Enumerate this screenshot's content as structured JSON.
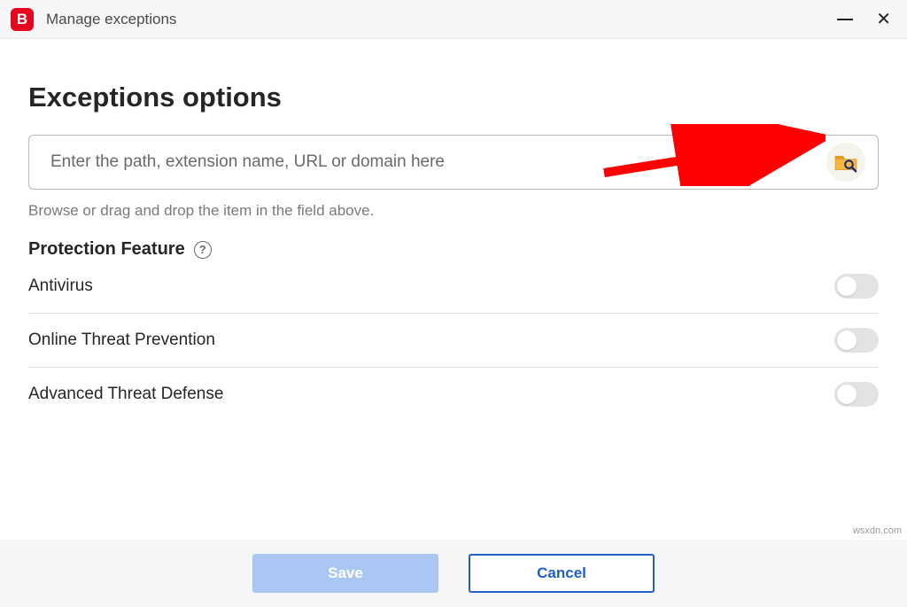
{
  "window": {
    "title": "Manage exceptions",
    "logo_letter": "B"
  },
  "page": {
    "heading": "Exceptions options",
    "input_placeholder": "Enter the path, extension name, URL or domain here",
    "hint": "Browse or drag and drop the item in the field above.",
    "protection_label": "Protection Feature"
  },
  "features": [
    {
      "label": "Antivirus",
      "enabled": false
    },
    {
      "label": "Online Threat Prevention",
      "enabled": false
    },
    {
      "label": "Advanced Threat Defense",
      "enabled": false
    }
  ],
  "footer": {
    "save": "Save",
    "cancel": "Cancel"
  },
  "attribution": "wsxdn.com"
}
